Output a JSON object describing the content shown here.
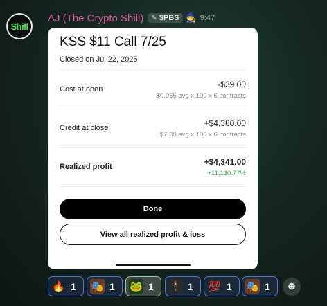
{
  "avatar": {
    "text": "Shill"
  },
  "message": {
    "sender": "AJ (The Crypto Shill)",
    "tag_icon": "✎",
    "tag": "$PBS",
    "sticker_emoji": "🧙",
    "time": "9:47"
  },
  "card": {
    "title": "KSS $11 Call 7/25",
    "closed": "Closed on Jul 22, 2025",
    "rows": [
      {
        "label": "Cost at open",
        "value": "-$39.00",
        "sub": "$0.065 avg x 100 x 6 contracts"
      },
      {
        "label": "Credit at close",
        "value": "+$4,380.00",
        "sub": "$7.30 avg x 100 x 6 contracts"
      },
      {
        "label": "Realized profit",
        "value": "+$4,341.00",
        "sub": "+11,130.77%"
      }
    ],
    "done_label": "Done",
    "view_label": "View all realized profit & loss",
    "colors": {
      "profit_green": "#2fb34a"
    }
  },
  "reactions": [
    {
      "emoji": "🔥",
      "count": "1"
    },
    {
      "emoji": "🎭",
      "count": "1"
    },
    {
      "emoji": "🐸",
      "count": "1"
    },
    {
      "emoji": "🕴",
      "count": "1"
    },
    {
      "emoji": "💯",
      "count": "1"
    },
    {
      "emoji": "🎭",
      "count": "1"
    }
  ],
  "add_reaction_icon": "☻"
}
